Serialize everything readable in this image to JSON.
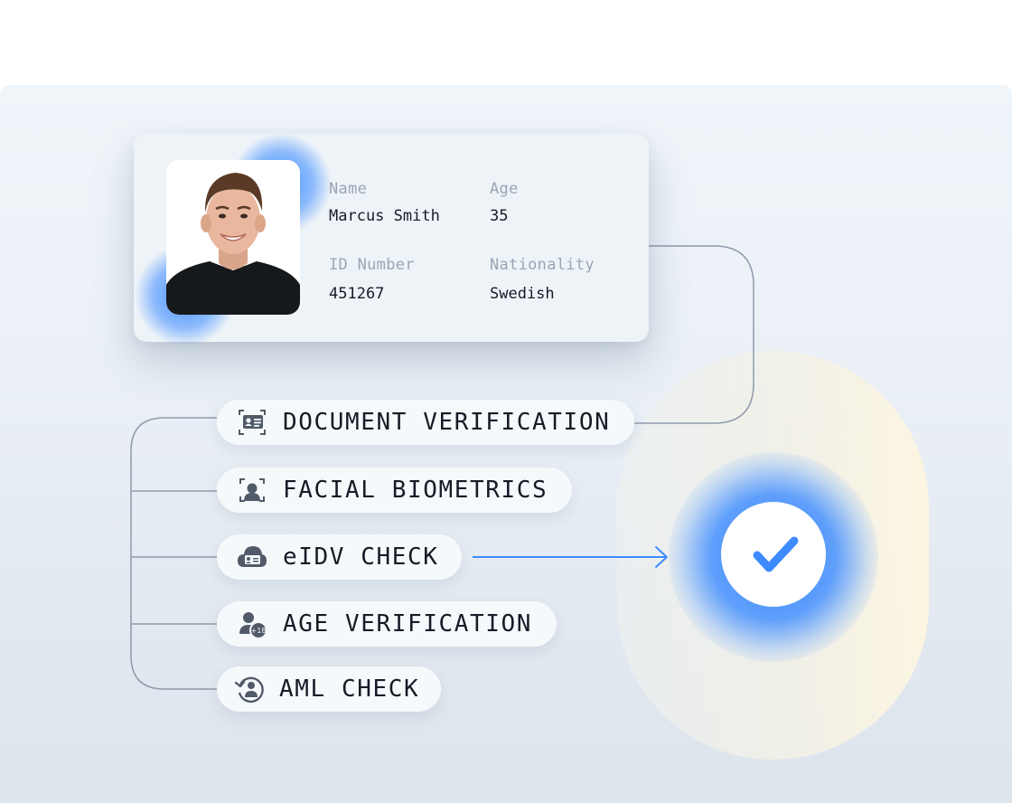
{
  "id_card": {
    "fields": [
      {
        "label": "Name",
        "value": "Marcus Smith"
      },
      {
        "label": "Age",
        "value": "35"
      },
      {
        "label": "ID Number",
        "value": "451267"
      },
      {
        "label": "Nationality",
        "value": "Swedish"
      }
    ],
    "photo_icon": "portrait-photo"
  },
  "checks": [
    {
      "label": "DOCUMENT VERIFICATION",
      "icon": "id-card-scan-icon"
    },
    {
      "label": "FACIAL BIOMETRICS",
      "icon": "face-scan-icon"
    },
    {
      "label": "eIDV CHECK",
      "icon": "cloud-id-icon"
    },
    {
      "label": "AGE VERIFICATION",
      "icon": "person-18-plus-icon"
    },
    {
      "label": "AML CHECK",
      "icon": "person-refresh-icon"
    }
  ],
  "age_badge_text": "+18",
  "result": {
    "icon": "checkmark-icon"
  },
  "colors": {
    "accent_blue": "#3d8bff",
    "connector_gray": "#8e9bab",
    "text_dark": "#161b26",
    "label_gray": "#9aa6b6",
    "icon_gray": "#505a68"
  }
}
